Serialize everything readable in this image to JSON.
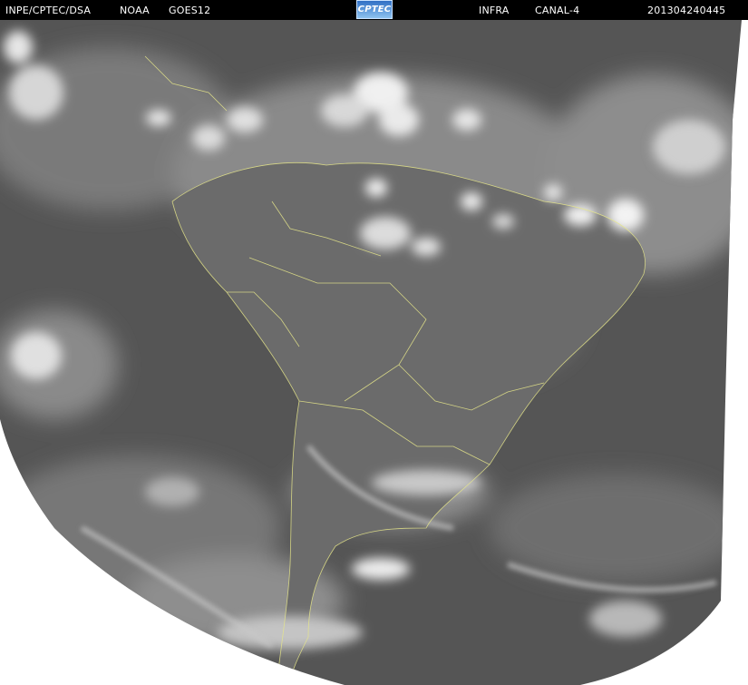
{
  "header": {
    "source": "INPE/CPTEC/DSA",
    "agency": "NOAA",
    "satellite": "GOES12",
    "logo_text": "CPTEC",
    "band": "INFRA",
    "channel": "CANAL-4",
    "timestamp": "201304240445"
  },
  "image": {
    "subject": "infrared satellite view of South America",
    "colors": {
      "background": "#ffffff",
      "earth_disk": "#595959",
      "ocean_dark": "#4a4a4a",
      "land": "#6a6a6a",
      "cloud_bright": "#f2f2f2",
      "cloud_mid": "#a8a8a8",
      "borders": "#e8e890"
    }
  }
}
